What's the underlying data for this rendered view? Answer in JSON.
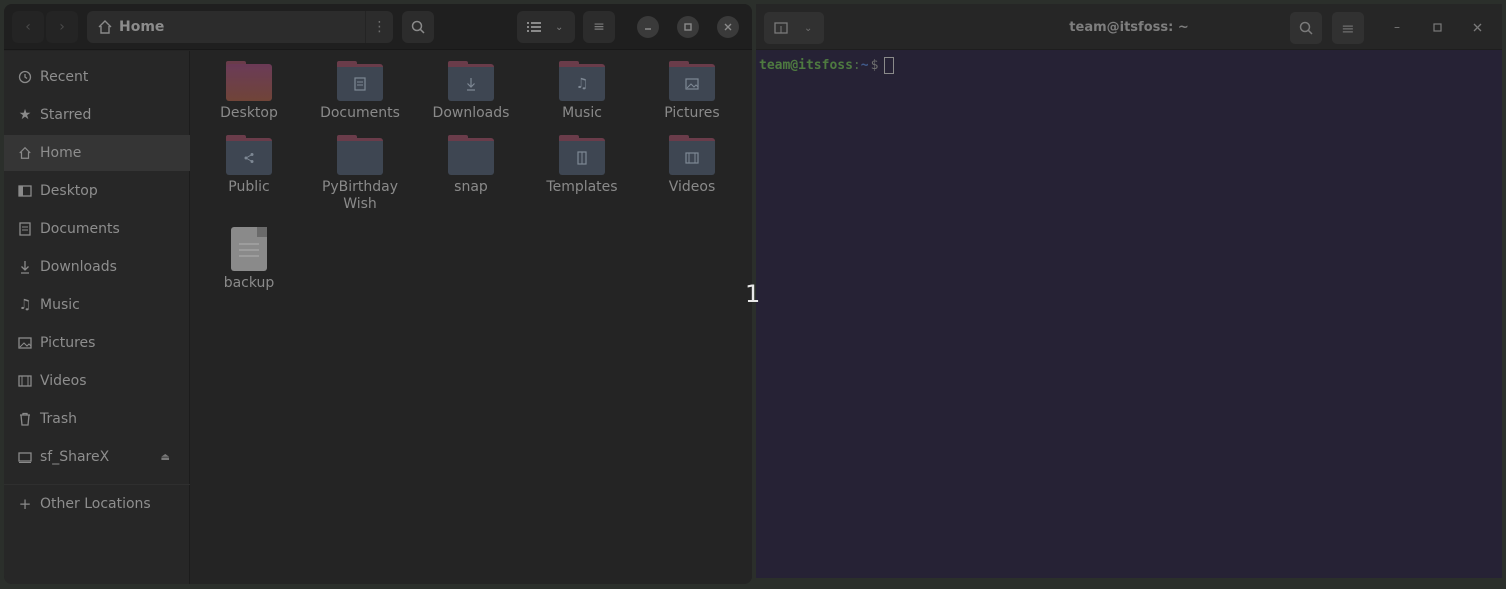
{
  "file_manager": {
    "path_label": "Home",
    "sidebar": [
      {
        "label": "Recent",
        "icon": "clock-icon"
      },
      {
        "label": "Starred",
        "icon": "star-icon"
      },
      {
        "label": "Home",
        "icon": "home-icon",
        "active": true
      },
      {
        "label": "Desktop",
        "icon": "desktop-icon"
      },
      {
        "label": "Documents",
        "icon": "documents-icon"
      },
      {
        "label": "Downloads",
        "icon": "download-icon"
      },
      {
        "label": "Music",
        "icon": "music-icon"
      },
      {
        "label": "Pictures",
        "icon": "pictures-icon"
      },
      {
        "label": "Videos",
        "icon": "videos-icon"
      },
      {
        "label": "Trash",
        "icon": "trash-icon"
      },
      {
        "label": "sf_ShareX",
        "icon": "drive-icon",
        "eject": true
      },
      {
        "label": "Other Locations",
        "icon": "plus-icon"
      }
    ],
    "items": [
      {
        "label": "Desktop",
        "type": "folder"
      },
      {
        "label": "Documents",
        "type": "folder"
      },
      {
        "label": "Downloads",
        "type": "folder"
      },
      {
        "label": "Music",
        "type": "folder"
      },
      {
        "label": "Pictures",
        "type": "folder"
      },
      {
        "label": "Public",
        "type": "folder"
      },
      {
        "label": "PyBirthday Wish",
        "type": "folder"
      },
      {
        "label": "snap",
        "type": "folder"
      },
      {
        "label": "Templates",
        "type": "folder"
      },
      {
        "label": "Videos",
        "type": "folder"
      },
      {
        "label": "backup",
        "type": "file"
      }
    ]
  },
  "terminal": {
    "title": "team@itsfoss: ~",
    "prompt_user": "team@itsfoss",
    "prompt_sep": ":",
    "prompt_path": "~",
    "prompt_symbol": "$"
  },
  "overlay_number": "1",
  "colors": {
    "folder_tab": "#6a3c4a",
    "folder_body": "#3e4652",
    "terminal_bg": "#262235",
    "sidebar_active": "#353535"
  }
}
